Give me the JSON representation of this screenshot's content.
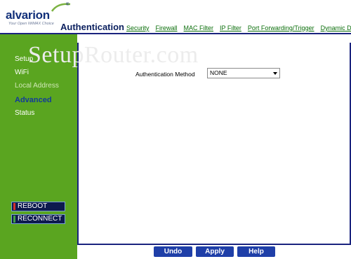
{
  "brand": {
    "logo_text": "alvarion",
    "tagline": "Your Open WiMAX Choice",
    "registered": "®"
  },
  "header": {
    "title": "Authentication",
    "nav": [
      {
        "label": "Security"
      },
      {
        "label": "Firewall"
      },
      {
        "label": "MAC Filter"
      },
      {
        "label": "IP Filter"
      },
      {
        "label": "Port Forwarding/Trigger"
      },
      {
        "label": "Dynamic DNS"
      }
    ]
  },
  "sidebar": {
    "items": [
      {
        "label": "Setup",
        "state": "normal"
      },
      {
        "label": "WiFi",
        "state": "normal"
      },
      {
        "label": "Local Address",
        "state": "disabled"
      },
      {
        "label": "Advanced",
        "state": "active"
      },
      {
        "label": "Status",
        "state": "normal"
      }
    ],
    "buttons": [
      {
        "label": "REBOOT",
        "mark_color": "#d32f2f"
      },
      {
        "label": "RECONNECT",
        "mark_color": "#43a047"
      }
    ]
  },
  "main": {
    "watermark": "SetupRouter.com",
    "auth_method_label": "Authentication Method",
    "auth_method_value": "NONE"
  },
  "footer": {
    "undo_label": "Undo",
    "apply_label": "Apply",
    "help_label": "Help"
  },
  "colors": {
    "sidebar_green": "#5aa520",
    "navy": "#1a237e",
    "button_blue": "#1f3fa8",
    "nav_link_green": "#0a6e0a"
  }
}
